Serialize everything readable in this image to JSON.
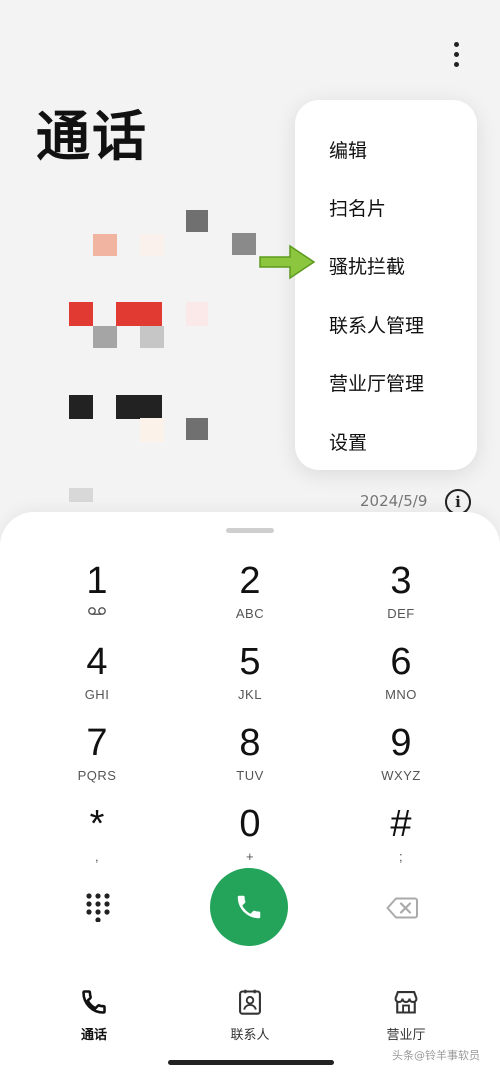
{
  "header": {
    "title": "通话",
    "more_icon": "more-vertical-icon"
  },
  "recent": {
    "date": "2024/5/9",
    "info_icon": "info-icon"
  },
  "menu": {
    "items": [
      "编辑",
      "扫名片",
      "骚扰拦截",
      "联系人管理",
      "营业厅管理",
      "设置"
    ]
  },
  "dialpad": {
    "keys": [
      {
        "digit": "1",
        "sub": ""
      },
      {
        "digit": "2",
        "sub": "ABC"
      },
      {
        "digit": "3",
        "sub": "DEF"
      },
      {
        "digit": "4",
        "sub": "GHI"
      },
      {
        "digit": "5",
        "sub": "JKL"
      },
      {
        "digit": "6",
        "sub": "MNO"
      },
      {
        "digit": "7",
        "sub": "PQRS"
      },
      {
        "digit": "8",
        "sub": "TUV"
      },
      {
        "digit": "9",
        "sub": "WXYZ"
      },
      {
        "digit": "*",
        "sub": ","
      },
      {
        "digit": "0",
        "sub": "+"
      },
      {
        "digit": "#",
        "sub": ";"
      }
    ],
    "call_color": "#23a45a"
  },
  "bottom_nav": {
    "items": [
      "通话",
      "联系人",
      "营业厅"
    ],
    "active": "通话"
  },
  "watermark": "头条@铃羊事软员"
}
